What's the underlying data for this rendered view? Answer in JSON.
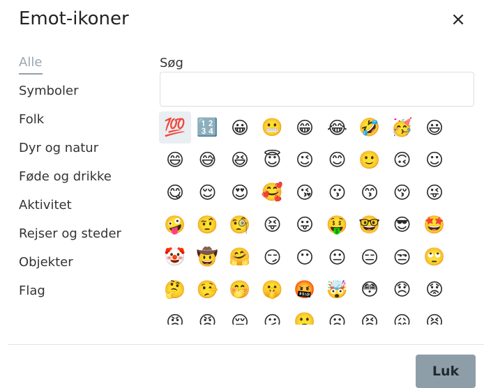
{
  "dialog": {
    "title": "Emot-ikoner",
    "close_label": "×"
  },
  "categories": [
    {
      "label": "Alle"
    },
    {
      "label": "Symboler"
    },
    {
      "label": "Folk"
    },
    {
      "label": "Dyr og natur"
    },
    {
      "label": "Føde og drikke"
    },
    {
      "label": "Aktivitet"
    },
    {
      "label": "Rejser og steder"
    },
    {
      "label": "Objekter"
    },
    {
      "label": "Flag"
    }
  ],
  "active_category": "Alle",
  "search": {
    "label": "Søg",
    "value": "",
    "placeholder": ""
  },
  "emoji_rows": [
    [
      {
        "char": "💯",
        "name": "hundred-points-emoji",
        "selected": true
      },
      {
        "char": "🔢",
        "name": "input-numbers-emoji"
      },
      {
        "char": "😀",
        "name": "grinning-face-emoji"
      },
      {
        "char": "😬",
        "name": "grimacing-face-emoji"
      },
      {
        "char": "😁",
        "name": "beaming-face-emoji"
      },
      {
        "char": "😂",
        "name": "tears-of-joy-emoji"
      },
      {
        "char": "🤣",
        "name": "rolling-laughing-emoji"
      },
      {
        "char": "🥳",
        "name": "partying-face-emoji"
      },
      {
        "char": "😃",
        "name": "grinning-big-eyes-emoji"
      }
    ],
    [
      {
        "char": "😄",
        "name": "grinning-smiling-eyes-emoji"
      },
      {
        "char": "😅",
        "name": "grinning-sweat-emoji"
      },
      {
        "char": "😆",
        "name": "squinting-laughing-emoji"
      },
      {
        "char": "😇",
        "name": "halo-face-emoji"
      },
      {
        "char": "😉",
        "name": "winking-face-emoji"
      },
      {
        "char": "😊",
        "name": "smiling-eyes-emoji"
      },
      {
        "char": "🙂",
        "name": "slightly-smiling-emoji"
      },
      {
        "char": "🙃",
        "name": "upside-down-emoji"
      },
      {
        "char": "☺",
        "name": "smiling-face-emoji"
      }
    ],
    [
      {
        "char": "😋",
        "name": "savoring-food-emoji"
      },
      {
        "char": "😌",
        "name": "relieved-face-emoji"
      },
      {
        "char": "😍",
        "name": "heart-eyes-emoji"
      },
      {
        "char": "🥰",
        "name": "smiling-hearts-emoji"
      },
      {
        "char": "😘",
        "name": "blowing-kiss-emoji"
      },
      {
        "char": "😗",
        "name": "kissing-face-emoji"
      },
      {
        "char": "😙",
        "name": "kissing-smiling-eyes-emoji"
      },
      {
        "char": "😚",
        "name": "kissing-closed-eyes-emoji"
      },
      {
        "char": "😜",
        "name": "winking-tongue-emoji"
      }
    ],
    [
      {
        "char": "🤪",
        "name": "zany-face-emoji"
      },
      {
        "char": "🤨",
        "name": "raised-eyebrow-emoji"
      },
      {
        "char": "🧐",
        "name": "monocle-face-emoji"
      },
      {
        "char": "😝",
        "name": "squinting-tongue-emoji"
      },
      {
        "char": "😛",
        "name": "tongue-face-emoji"
      },
      {
        "char": "🤑",
        "name": "money-mouth-emoji"
      },
      {
        "char": "🤓",
        "name": "nerd-face-emoji"
      },
      {
        "char": "😎",
        "name": "sunglasses-face-emoji"
      },
      {
        "char": "🤩",
        "name": "star-struck-emoji"
      }
    ],
    [
      {
        "char": "🤡",
        "name": "clown-face-emoji"
      },
      {
        "char": "🤠",
        "name": "cowboy-face-emoji"
      },
      {
        "char": "🤗",
        "name": "hugging-face-emoji"
      },
      {
        "char": "😏",
        "name": "smirking-face-emoji"
      },
      {
        "char": "😶",
        "name": "no-mouth-emoji"
      },
      {
        "char": "😐",
        "name": "neutral-face-emoji"
      },
      {
        "char": "😑",
        "name": "expressionless-face-emoji"
      },
      {
        "char": "😒",
        "name": "unamused-face-emoji"
      },
      {
        "char": "🙄",
        "name": "rolling-eyes-emoji"
      }
    ],
    [
      {
        "char": "🤔",
        "name": "thinking-face-emoji"
      },
      {
        "char": "🤥",
        "name": "lying-face-emoji"
      },
      {
        "char": "🤭",
        "name": "hand-over-mouth-emoji"
      },
      {
        "char": "🤫",
        "name": "shushing-face-emoji"
      },
      {
        "char": "🤬",
        "name": "cursing-face-emoji"
      },
      {
        "char": "🤯",
        "name": "exploding-head-emoji"
      },
      {
        "char": "😳",
        "name": "flushed-face-emoji"
      },
      {
        "char": "😞",
        "name": "disappointed-face-emoji"
      },
      {
        "char": "😟",
        "name": "worried-face-emoji"
      }
    ],
    [
      {
        "char": "😠",
        "name": "angry-face-emoji"
      },
      {
        "char": "😡",
        "name": "pouting-face-emoji"
      },
      {
        "char": "😔",
        "name": "pensive-face-emoji"
      },
      {
        "char": "😕",
        "name": "confused-face-emoji"
      },
      {
        "char": "🙁",
        "name": "frowning-face-emoji"
      },
      {
        "char": "☹",
        "name": "frowning-outline-emoji"
      },
      {
        "char": "😣",
        "name": "persevering-face-emoji"
      },
      {
        "char": "😖",
        "name": "confounded-face-emoji"
      },
      {
        "char": "😫",
        "name": "tired-face-emoji"
      }
    ]
  ],
  "footer": {
    "close_button": "Luk"
  },
  "colors": {
    "accent": "#8e9ea9",
    "active_category": "#9aa6b0",
    "selected_bg": "#e8eef2"
  }
}
